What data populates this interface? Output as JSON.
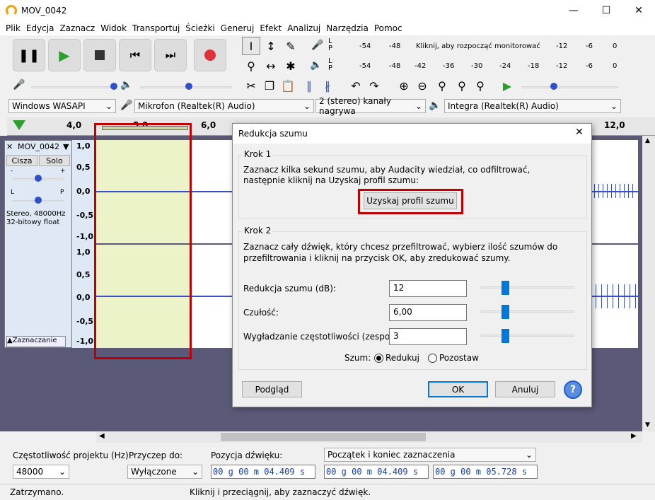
{
  "app": {
    "title": "MOV_0042"
  },
  "menu": [
    "Plik",
    "Edycja",
    "Zaznacz",
    "Widok",
    "Transportuj",
    "Ścieżki",
    "Generuj",
    "Efekt",
    "Analizuj",
    "Narzędzia",
    "Pomoc"
  ],
  "meter": {
    "rec_scale": [
      "-54",
      "-48",
      "-12",
      "-6",
      "0"
    ],
    "rec_prompt": "Kliknij, aby rozpocząć monitorować",
    "play_scale": [
      "-54",
      "-48",
      "-42",
      "-36",
      "-30",
      "-24",
      "-18",
      "-12",
      "-6",
      "0"
    ],
    "lr": [
      "L",
      "P"
    ]
  },
  "devices": {
    "host": "Windows WASAPI",
    "mic": "Mikrofon (Realtek(R) Audio)",
    "channels": "2 (stereo) kanały nagrywa",
    "speaker": "Integra (Realtek(R) Audio)"
  },
  "ruler": [
    "4,0",
    "5,0",
    "6,0",
    "12,0"
  ],
  "track": {
    "name": "MOV_0042",
    "mute": "Cisza",
    "solo": "Solo",
    "info1": "Stereo, 48000Hz",
    "info2": "32-bitowy float",
    "select": "Zaznaczanie",
    "gain_lr": [
      "-",
      "+"
    ],
    "pan_lr": [
      "L",
      "P"
    ],
    "yaxis": [
      "1,0",
      "0,5",
      "0,0",
      "-0,5",
      "-1,0"
    ]
  },
  "dialog": {
    "title": "Redukcja szumu",
    "step1": {
      "label": "Krok 1",
      "text1": "Zaznacz kilka sekund szumu, aby Audacity wiedział, co odfiltrować,",
      "text2": "następnie kliknij na Uzyskaj profil szumu:",
      "button": "Uzyskaj profil szumu"
    },
    "step2": {
      "label": "Krok 2",
      "text1": "Zaznacz cały dźwięk, który chcesz przefiltrować, wybierz ilość szumów do",
      "text2": "przefiltrowania i kliknij na przycisk OK, aby zredukować szumy."
    },
    "params": [
      {
        "label": "Redukcja szumu (dB):",
        "value": "12",
        "level": 0.18
      },
      {
        "label": "Czułość:",
        "value": "6,00",
        "level": 0.18
      },
      {
        "label": "Wygładzanie częstotliwości (zespoły):",
        "value": "3",
        "level": 0.18
      }
    ],
    "noise": {
      "label": "Szum:",
      "opt1": "Redukuj",
      "opt2": "Pozostaw",
      "selected": "Redukuj"
    },
    "preview": "Podgląd",
    "ok": "OK",
    "cancel": "Anuluj",
    "help": "?"
  },
  "bottom": {
    "rate_label": "Częstotliwość projektu (Hz):",
    "rate": "48000",
    "snap_label": "Przyczep do:",
    "snap": "Wyłączone",
    "pos_label": "Pozycja dźwięku:",
    "pos": "00 g 00 m 04.409 s",
    "sel_mode": "Początek i koniec zaznaczenia",
    "sel_start": "00 g 00 m 04.409 s",
    "sel_end": "00 g 00 m 05.728 s"
  },
  "status": {
    "left": "Zatrzymano.",
    "right": "Kliknij i przeciągnij, aby zaznaczyć dźwięk."
  }
}
